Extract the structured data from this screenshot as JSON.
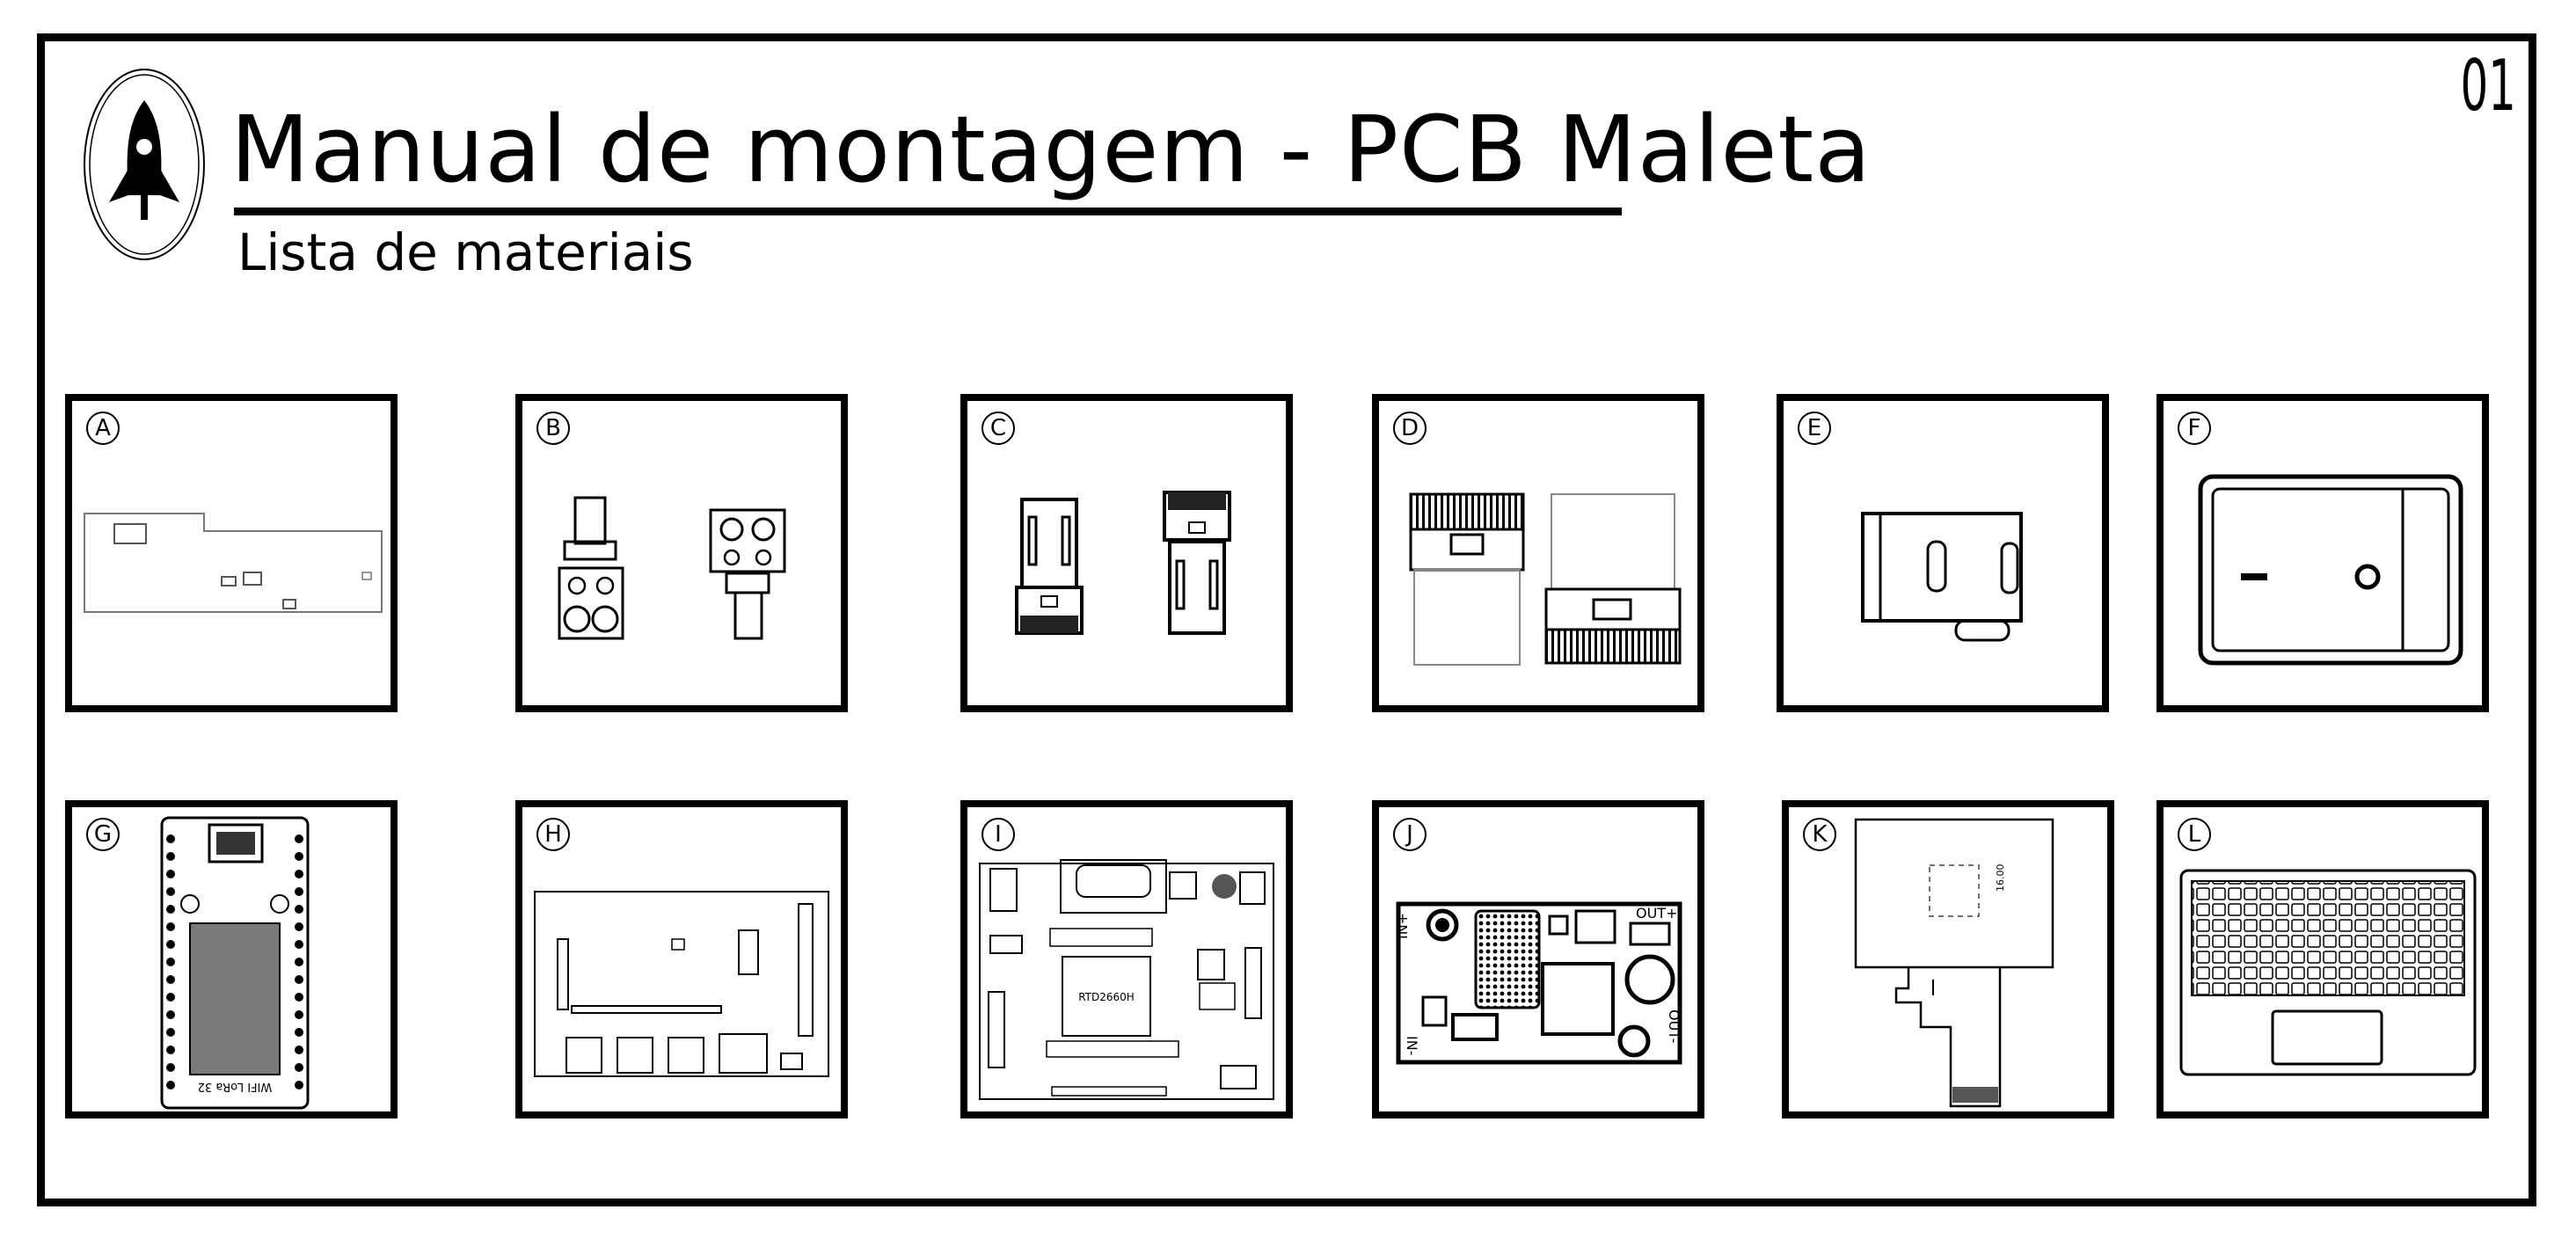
{
  "page": {
    "title": "Manual de montagem - PCB Maleta",
    "subtitle": "Lista de materiais",
    "page_number": "01"
  },
  "components": [
    {
      "letter": "A",
      "icon": "pcb-board-outline-icon"
    },
    {
      "letter": "B",
      "icon": "screw-terminal-connector-icon"
    },
    {
      "letter": "C",
      "icon": "xt-connector-pair-icon"
    },
    {
      "letter": "D",
      "icon": "ribbon-connector-icon"
    },
    {
      "letter": "E",
      "icon": "battery-holder-clip-icon"
    },
    {
      "letter": "F",
      "icon": "rocker-switch-icon"
    },
    {
      "letter": "G",
      "icon": "wifi-lora-32-module-icon",
      "label": "WIFI LoRa 32"
    },
    {
      "letter": "H",
      "icon": "single-board-computer-icon"
    },
    {
      "letter": "I",
      "icon": "lcd-driver-board-icon",
      "label": "RTD2660H"
    },
    {
      "letter": "J",
      "icon": "dc-dc-converter-icon",
      "labels": [
        "IN+",
        "IN-",
        "OUT+",
        "OUT-"
      ]
    },
    {
      "letter": "K",
      "icon": "lcd-display-panel-icon",
      "label": "16.00"
    },
    {
      "letter": "L",
      "icon": "laptop-keyboard-icon"
    }
  ]
}
